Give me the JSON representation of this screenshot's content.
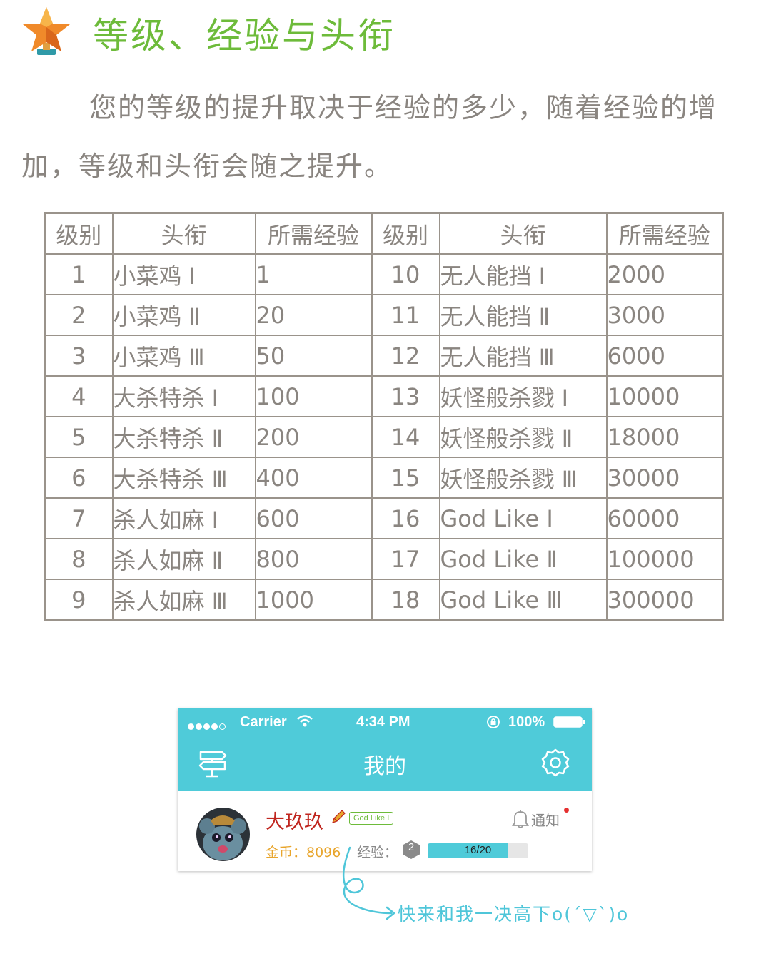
{
  "header": {
    "title": "等级、经验与头衔",
    "star_icon": "star-trophy-icon",
    "accent_color": "#6dbb3a"
  },
  "intro": "您的等级的提升取决于经验的多少，随着经验的增加，等级和头衔会随之提升。",
  "table": {
    "headers": [
      "级别",
      "头衔",
      "所需经验",
      "级别",
      "头衔",
      "所需经验"
    ],
    "rows": [
      [
        "1",
        "小菜鸡 Ⅰ",
        "1",
        "10",
        "无人能挡 Ⅰ",
        "2000"
      ],
      [
        "2",
        "小菜鸡 Ⅱ",
        "20",
        "11",
        "无人能挡 Ⅱ",
        "3000"
      ],
      [
        "3",
        "小菜鸡 Ⅲ",
        "50",
        "12",
        "无人能挡 Ⅲ",
        "6000"
      ],
      [
        "4",
        "大杀特杀 Ⅰ",
        "100",
        "13",
        "妖怪般杀戮 Ⅰ",
        "10000"
      ],
      [
        "5",
        "大杀特杀 Ⅱ",
        "200",
        "14",
        "妖怪般杀戮 Ⅱ",
        "18000"
      ],
      [
        "6",
        "大杀特杀 Ⅲ",
        "400",
        "15",
        "妖怪般杀戮 Ⅲ",
        "30000"
      ],
      [
        "7",
        "杀人如麻 Ⅰ",
        "600",
        "16",
        "God Like Ⅰ",
        "60000"
      ],
      [
        "8",
        "杀人如麻 Ⅱ",
        "800",
        "17",
        "God Like Ⅱ",
        "100000"
      ],
      [
        "9",
        "杀人如麻 Ⅲ",
        "1000",
        "18",
        "God Like Ⅲ",
        "300000"
      ]
    ]
  },
  "phone": {
    "status_bar": {
      "carrier": "Carrier",
      "time": "4:34 PM",
      "battery": "100%"
    },
    "nav": {
      "title": "我的",
      "left_icon": "signpost-icon",
      "right_icon": "gear-icon"
    },
    "profile": {
      "username": "大玖玖",
      "rank_badge": "God Like Ⅰ",
      "notify_label": "通知",
      "coins": "金币：8096",
      "exp_label": "经验：",
      "level": "2",
      "exp_progress": "16/20",
      "exp_fraction": 0.8
    },
    "theme_color": "#4fcbd9"
  },
  "callout": "快来和我一决高下o(ˊ▽ˋ)o"
}
